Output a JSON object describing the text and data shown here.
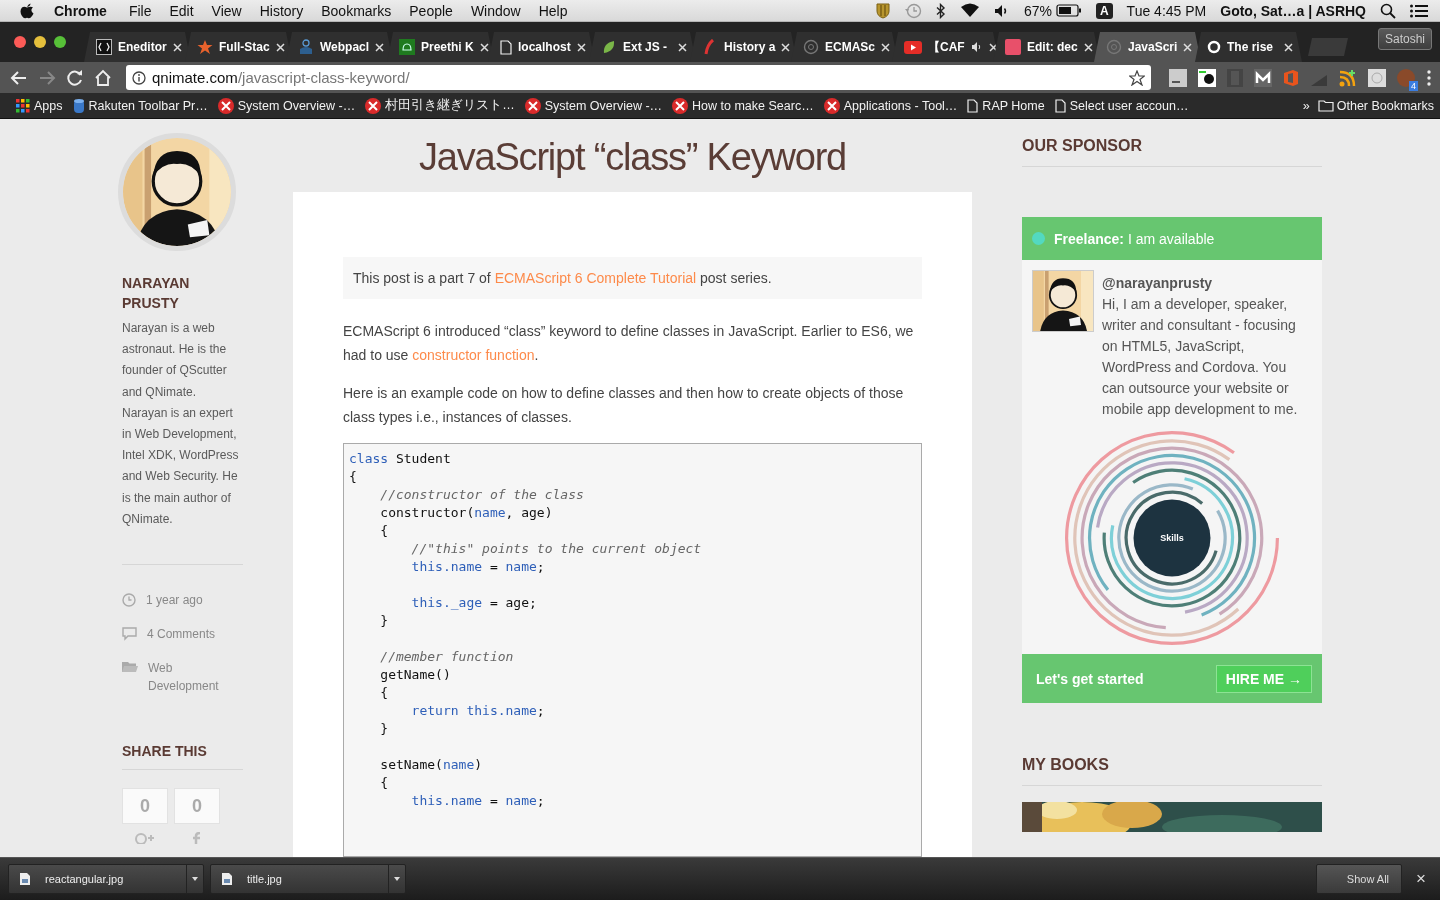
{
  "menu_bar": {
    "app": "Chrome",
    "menus": [
      "File",
      "Edit",
      "View",
      "History",
      "Bookmarks",
      "People",
      "Window",
      "Help"
    ],
    "battery": "67%",
    "input_source": "A",
    "clock": "Tue 4:45 PM",
    "user": "Goto, Sat…a | ASRHQ"
  },
  "tabs": [
    {
      "title": "Eneditor",
      "kind": "code",
      "selected": false,
      "audio": false
    },
    {
      "title": "Full-Stac",
      "kind": "star",
      "selected": false,
      "audio": false
    },
    {
      "title": "Webpacl",
      "kind": "person",
      "selected": false,
      "audio": false
    },
    {
      "title": "Preethi K",
      "kind": "android",
      "selected": false,
      "audio": false
    },
    {
      "title": "localhost",
      "kind": "page",
      "selected": false,
      "audio": false
    },
    {
      "title": "Ext JS - ",
      "kind": "leaf",
      "selected": false,
      "audio": false
    },
    {
      "title": "History a",
      "kind": "slash",
      "selected": false,
      "audio": false
    },
    {
      "title": "ECMASc",
      "kind": "globe",
      "selected": false,
      "audio": false
    },
    {
      "title": "【CAF",
      "kind": "video",
      "selected": false,
      "audio": true
    },
    {
      "title": "Edit: dec",
      "kind": "square",
      "selected": false,
      "audio": false
    },
    {
      "title": "JavaScri",
      "kind": "globe",
      "selected": true,
      "audio": false
    },
    {
      "title": "The rise",
      "kind": "ring",
      "selected": false,
      "audio": false
    }
  ],
  "profile": "Satoshi",
  "toolbar": {
    "forward_disabled": true,
    "host": "qnimate.com",
    "path": "/javascript-class-keyword/",
    "extension_badge": "4"
  },
  "bookmarks": [
    {
      "label": "Apps",
      "kind": "apps"
    },
    {
      "label": "Rakuten Toolbar Pr…",
      "kind": "db"
    },
    {
      "label": "System Overview -…",
      "kind": "tool"
    },
    {
      "label": "村田引き継ぎリスト…",
      "kind": "tool"
    },
    {
      "label": "System Overview -…",
      "kind": "tool"
    },
    {
      "label": "How to make Searc…",
      "kind": "tool"
    },
    {
      "label": "Applications - Tool…",
      "kind": "tool"
    },
    {
      "label": "RAP Home",
      "kind": "page"
    },
    {
      "label": "Select user accoun…",
      "kind": "page"
    }
  ],
  "bookmarks_overflow": "»",
  "other_bookmarks": "Other Bookmarks",
  "author": {
    "name": "NARAYAN PRUSTY",
    "bio": "Narayan is a web astronaut. He is the founder of QScutter and QNimate. Narayan is an expert in Web Development, Intel XDK, WordPress and Web Security. He is the main author of QNimate.",
    "meta": [
      {
        "kind": "clock",
        "text": "1 year ago"
      },
      {
        "kind": "comment",
        "text": "4 Comments"
      },
      {
        "kind": "folder",
        "text": "Web Development"
      }
    ]
  },
  "share": {
    "heading": "SHARE THIS",
    "counts": [
      {
        "kind": "google-plus",
        "count": "0"
      },
      {
        "kind": "facebook",
        "count": "0"
      }
    ]
  },
  "article": {
    "title": "JavaScript “class” Keyword",
    "notice": [
      {
        "text": "This post is a part 7 of "
      },
      {
        "text": "ECMAScript 6 Complete Tutorial",
        "link": true
      },
      {
        "text": " post series."
      }
    ],
    "paragraphs": [
      [
        {
          "text": "ECMAScript 6 introduced “class” keyword to define classes in JavaScript. Earlier to ES6, we had to use "
        },
        {
          "text": "constructor function",
          "link": true
        },
        {
          "text": "."
        }
      ],
      [
        {
          "text": "Here is an example code on how to define classes and then how to create objects of those class types i.e., instances of classes."
        }
      ]
    ],
    "code": [
      {
        "kind": "code",
        "tokens": [
          {
            "t": "class",
            "kind": "keyword"
          },
          {
            "t": " Student",
            "kind": "plain"
          }
        ]
      },
      {
        "kind": "code",
        "tokens": [
          {
            "t": "{",
            "kind": "plain"
          }
        ]
      },
      {
        "kind": "code",
        "tokens": [
          {
            "t": "    //constructor of the class",
            "kind": "comment"
          }
        ]
      },
      {
        "kind": "code",
        "tokens": [
          {
            "t": "    constructor(",
            "kind": "plain"
          },
          {
            "t": "name",
            "kind": "keyword"
          },
          {
            "t": ", age)",
            "kind": "plain"
          }
        ]
      },
      {
        "kind": "code",
        "tokens": [
          {
            "t": "    {",
            "kind": "plain"
          }
        ]
      },
      {
        "kind": "code",
        "tokens": [
          {
            "t": "        //\"this\" points to the current object",
            "kind": "comment"
          }
        ]
      },
      {
        "kind": "code",
        "tokens": [
          {
            "t": "        this.name",
            "kind": "keyword"
          },
          {
            "t": " = ",
            "kind": "plain"
          },
          {
            "t": "name",
            "kind": "keyword"
          },
          {
            "t": ";",
            "kind": "plain"
          }
        ]
      },
      {
        "kind": "blank"
      },
      {
        "kind": "code",
        "tokens": [
          {
            "t": "        this._age",
            "kind": "keyword"
          },
          {
            "t": " = age;",
            "kind": "plain"
          }
        ]
      },
      {
        "kind": "code",
        "tokens": [
          {
            "t": "    }",
            "kind": "plain"
          }
        ]
      },
      {
        "kind": "blank"
      },
      {
        "kind": "code",
        "tokens": [
          {
            "t": "    //member function",
            "kind": "comment"
          }
        ]
      },
      {
        "kind": "code",
        "tokens": [
          {
            "t": "    getName()",
            "kind": "plain"
          }
        ]
      },
      {
        "kind": "code",
        "tokens": [
          {
            "t": "    {",
            "kind": "plain"
          }
        ]
      },
      {
        "kind": "code",
        "tokens": [
          {
            "t": "        return this.name",
            "kind": "keyword"
          },
          {
            "t": ";",
            "kind": "plain"
          }
        ]
      },
      {
        "kind": "code",
        "tokens": [
          {
            "t": "    }",
            "kind": "plain"
          }
        ]
      },
      {
        "kind": "blank"
      },
      {
        "kind": "code",
        "tokens": [
          {
            "t": "    setName(",
            "kind": "plain"
          },
          {
            "t": "name",
            "kind": "keyword"
          },
          {
            "t": ")",
            "kind": "plain"
          }
        ]
      },
      {
        "kind": "code",
        "tokens": [
          {
            "t": "    {",
            "kind": "plain"
          }
        ]
      },
      {
        "kind": "code",
        "tokens": [
          {
            "t": "        this.name",
            "kind": "keyword"
          },
          {
            "t": " = ",
            "kind": "plain"
          },
          {
            "t": "name",
            "kind": "keyword"
          },
          {
            "t": ";",
            "kind": "plain"
          }
        ]
      }
    ]
  },
  "sponsor": {
    "heading": "OUR SPONSOR",
    "status": "**Freelance:** I am available",
    "handle": "@narayanprusty",
    "bio": "Hi, I am a developer, speaker, writer and consultant - focusing on HTML5, JavaScript, WordPress and Cordova. You can outsource your website or mobile app development to me.",
    "chart_label": "Skills",
    "cta": "Let's get started",
    "button": "HIRE ME →"
  },
  "books": {
    "heading": "MY BOOKS"
  },
  "downloads": [
    {
      "name": "reactangular.jpg"
    },
    {
      "name": "title.jpg"
    }
  ],
  "show_all": "Show All",
  "close": "×"
}
